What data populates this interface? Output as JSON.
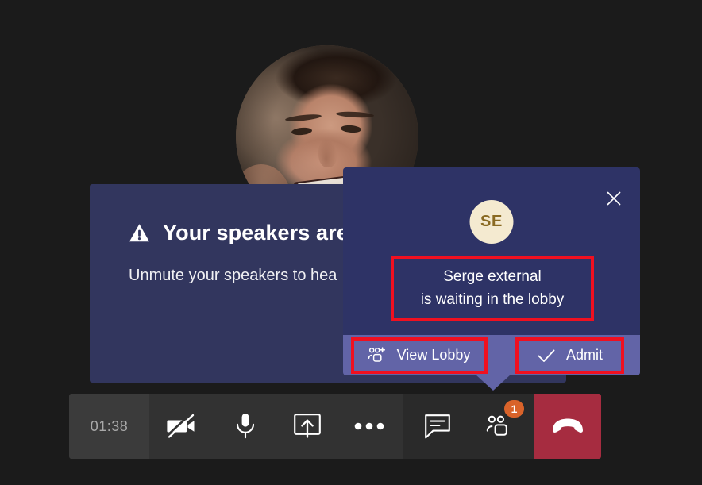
{
  "meeting": {
    "participant_photo_alt": "participant-video-tile"
  },
  "speakers_dialog": {
    "icon": "warning-triangle-icon",
    "title": "Your speakers are",
    "body": "Unmute your speakers to hea"
  },
  "lobby_popup": {
    "close_icon": "close-icon",
    "avatar_initials": "SE",
    "message_line_1": "Serge external",
    "message_line_2": "is waiting in the lobby",
    "view_lobby_label": "View Lobby",
    "view_lobby_icon": "people-add-icon",
    "admit_label": "Admit",
    "admit_icon": "checkmark-icon",
    "highlight_color": "#f01020",
    "panel_color": "#2e3366",
    "footer_color": "#6264a7",
    "avatar_bg": "#f4ead0",
    "avatar_fg": "#8a6a22"
  },
  "control_bar": {
    "timer": "01:38",
    "buttons": [
      {
        "name": "camera-off-icon",
        "label": "Camera"
      },
      {
        "name": "microphone-icon",
        "label": "Microphone"
      },
      {
        "name": "share-screen-icon",
        "label": "Share"
      },
      {
        "name": "more-options-icon",
        "label": "More actions"
      },
      {
        "name": "chat-icon",
        "label": "Chat"
      },
      {
        "name": "people-icon",
        "label": "Participants"
      }
    ],
    "people_badge_count": "1",
    "badge_color": "#d9632a",
    "hangup_icon": "hangup-icon",
    "hangup_color": "#a62c40"
  }
}
